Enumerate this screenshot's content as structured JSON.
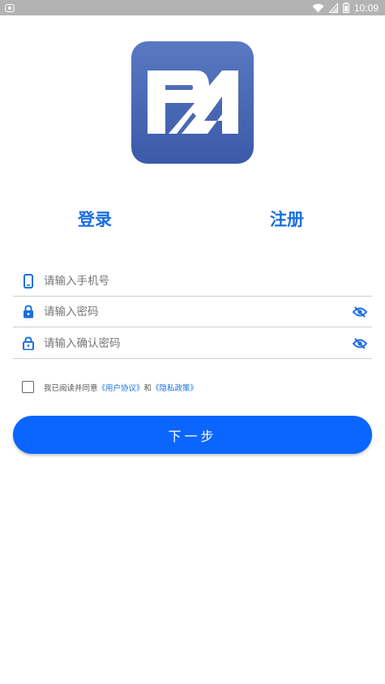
{
  "status_bar": {
    "time": "10:09",
    "icons": [
      "notification-icon",
      "wifi-icon",
      "signal-icon",
      "battery-icon"
    ]
  },
  "logo": {
    "text": "PA",
    "colors": {
      "top": "#5a79c2",
      "bottom": "#3b5aa8"
    }
  },
  "tabs": {
    "login": "登录",
    "register": "注册"
  },
  "fields": {
    "phone": {
      "placeholder": "请输入手机号",
      "icon": "phone-icon"
    },
    "password": {
      "placeholder": "请输入密码",
      "icon": "lock-icon",
      "toggle_icon": "eye-off-icon"
    },
    "confirm": {
      "placeholder": "请输入确认密码",
      "icon": "lock-icon",
      "toggle_icon": "eye-off-icon"
    }
  },
  "agreement": {
    "prefix": "我已阅读并同意",
    "user_agreement": "《用户协议》",
    "and": "和",
    "privacy_policy": "《隐私政策》",
    "checked": false
  },
  "next_button": {
    "label": "下一步"
  },
  "colors": {
    "accent": "#1a6fe0",
    "button": "#0a66ff",
    "status_bar": "#b3b3b3"
  }
}
